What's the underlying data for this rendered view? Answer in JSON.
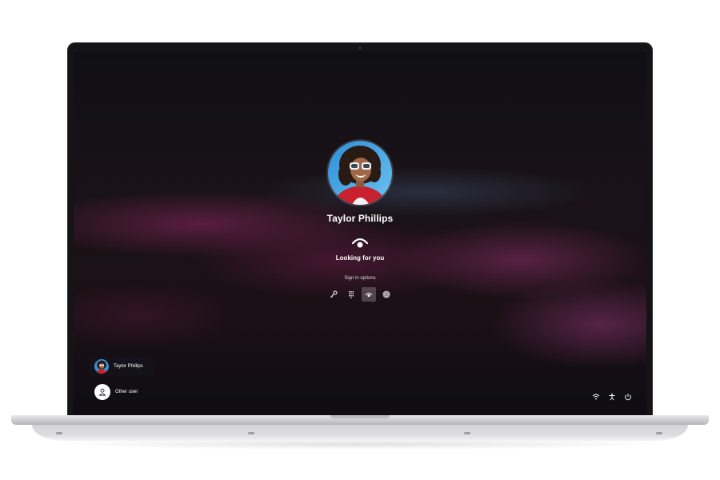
{
  "user": {
    "name": "Taylor Phillips"
  },
  "login": {
    "status": "Looking for you",
    "sign_in_options_label": "Sign in options",
    "options": [
      {
        "icon": "key-icon",
        "active": false
      },
      {
        "icon": "pin-keypad-icon",
        "active": false
      },
      {
        "icon": "face-recognition-icon",
        "active": true
      },
      {
        "icon": "fingerprint-icon",
        "active": false
      }
    ]
  },
  "user_list": [
    {
      "name": "Taylor Phillips",
      "selected": true
    },
    {
      "name": "Other user",
      "selected": false
    }
  ],
  "tray": [
    "wifi-icon",
    "accessibility-icon",
    "power-icon"
  ],
  "colors": {
    "accent_pink": "#b5346e",
    "accent_blue": "#4a7aa8"
  }
}
